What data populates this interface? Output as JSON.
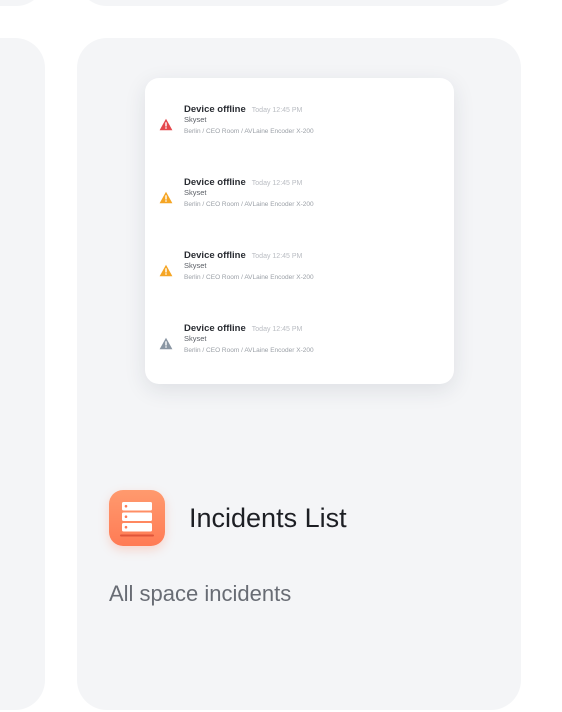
{
  "card": {
    "title": "Incidents List",
    "description": "All space incidents",
    "icon": "server-list-icon",
    "icon_color": "#ff8a5f"
  },
  "preview": {
    "incidents": [
      {
        "title": "Device offline",
        "time": "Today 12:45 PM",
        "organization": "Skyset",
        "path": "Berlin / CEO Room / AVLaine Encoder X-200",
        "severity": "critical",
        "icon": "warning-triangle-icon",
        "color": "#e5484d"
      },
      {
        "title": "Device offline",
        "time": "Today 12:45 PM",
        "organization": "Skyset",
        "path": "Berlin / CEO Room / AVLaine Encoder X-200",
        "severity": "warning",
        "icon": "warning-triangle-icon",
        "color": "#f5a524"
      },
      {
        "title": "Device offline",
        "time": "Today 12:45 PM",
        "organization": "Skyset",
        "path": "Berlin / CEO Room / AVLaine Encoder X-200",
        "severity": "warning",
        "icon": "warning-triangle-icon",
        "color": "#f5a524"
      },
      {
        "title": "Device offline",
        "time": "Today 12:45 PM",
        "organization": "Skyset",
        "path": "Berlin / CEO Room / AVLaine Encoder X-200",
        "severity": "info",
        "icon": "warning-triangle-icon",
        "color": "#8a96a3"
      }
    ]
  }
}
